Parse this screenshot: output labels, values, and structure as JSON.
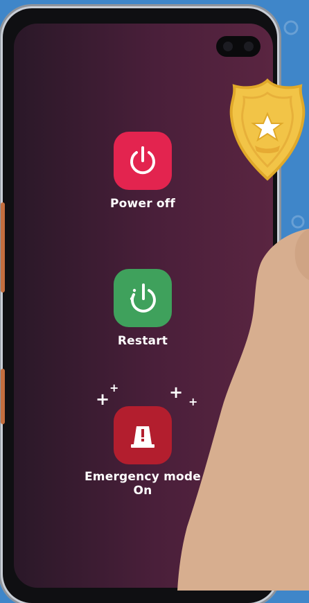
{
  "menu": {
    "power_off": {
      "label": "Power off",
      "icon": "power-icon",
      "color": "#e3244f"
    },
    "restart": {
      "label": "Restart",
      "icon": "restart-icon",
      "color": "#3fa15c"
    },
    "emergency": {
      "label_line1": "Emergency mode",
      "label_line2": "On",
      "icon": "emergency-light-icon",
      "color": "#b31e2e"
    }
  },
  "decor": {
    "badge_icon": "police-badge-icon",
    "hand": "hand-illustration"
  }
}
